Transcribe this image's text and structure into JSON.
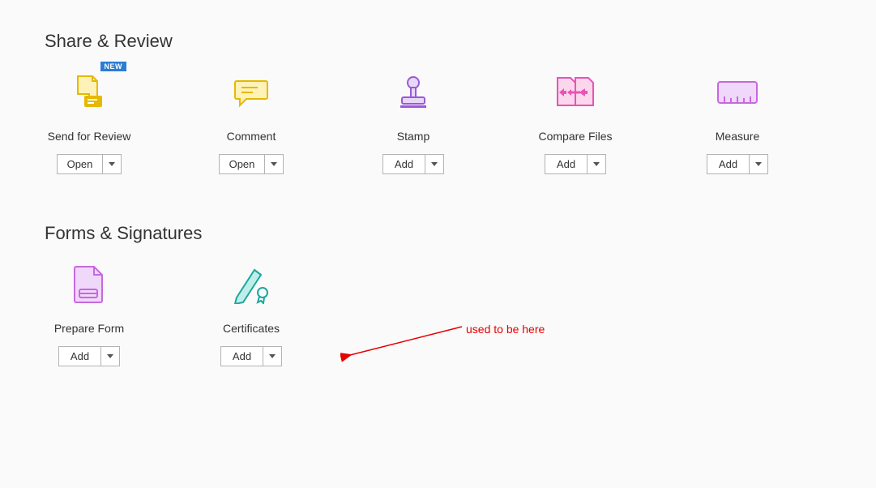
{
  "sections": {
    "share_review": {
      "title": "Share & Review",
      "tools": {
        "send_for_review": {
          "label": "Send for Review",
          "button": "Open",
          "badge": "NEW"
        },
        "comment": {
          "label": "Comment",
          "button": "Open"
        },
        "stamp": {
          "label": "Stamp",
          "button": "Add"
        },
        "compare_files": {
          "label": "Compare Files",
          "button": "Add"
        },
        "measure": {
          "label": "Measure",
          "button": "Add"
        }
      }
    },
    "forms_signatures": {
      "title": "Forms & Signatures",
      "tools": {
        "prepare_form": {
          "label": "Prepare Form",
          "button": "Add"
        },
        "certificates": {
          "label": "Certificates",
          "button": "Add"
        }
      }
    }
  },
  "annotation": {
    "text": "used to be here",
    "color": "#e60000"
  }
}
